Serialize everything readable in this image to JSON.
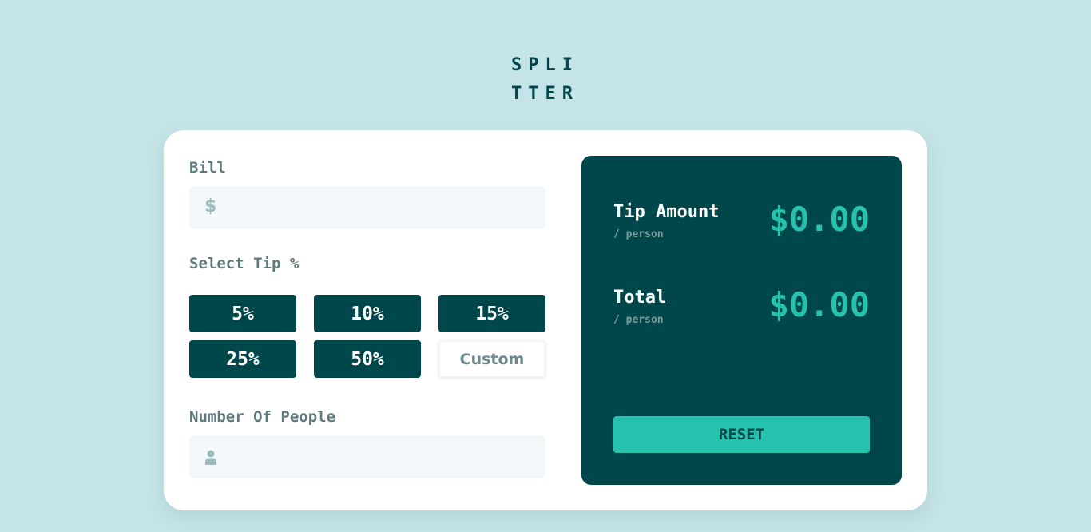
{
  "logo": {
    "line1": "SPLI",
    "line2": "TTER"
  },
  "bill": {
    "label": "Bill",
    "value": "",
    "currency_symbol": "$"
  },
  "tip": {
    "label": "Select Tip %",
    "options": [
      "5%",
      "10%",
      "15%",
      "25%",
      "50%"
    ],
    "custom_placeholder": "Custom"
  },
  "people": {
    "label": "Number Of People",
    "value": ""
  },
  "results": {
    "tip_amount": {
      "label": "Tip Amount",
      "sub": "/ person",
      "value": "$0.00"
    },
    "total": {
      "label": "Total",
      "sub": "/ person",
      "value": "$0.00"
    },
    "reset_label": "RESET"
  },
  "colors": {
    "background": "#c5e4e7",
    "dark_cyan": "#00474b",
    "strong_cyan": "#26c2ad",
    "input_bg": "#f3f9fa"
  }
}
